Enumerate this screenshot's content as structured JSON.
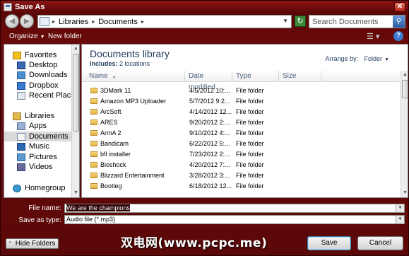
{
  "window": {
    "title": "Save As"
  },
  "address_bar": {
    "segments": [
      "Libraries",
      "Documents"
    ]
  },
  "search": {
    "placeholder": "Search Documents"
  },
  "toolbar": {
    "organize_label": "Organize",
    "new_folder_label": "New folder"
  },
  "nav_pane": {
    "items": [
      {
        "label": "Favorites",
        "icon": "star-icon",
        "group": true
      },
      {
        "label": "Desktop",
        "icon": "desktop-icon"
      },
      {
        "label": "Downloads",
        "icon": "downloads-icon"
      },
      {
        "label": "Dropbox",
        "icon": "dropbox-icon"
      },
      {
        "label": "Recent Places",
        "icon": "recent-places-icon"
      },
      {
        "label": "Libraries",
        "icon": "libraries-icon",
        "group": true
      },
      {
        "label": "Apps",
        "icon": "apps-library-icon"
      },
      {
        "label": "Documents",
        "icon": "documents-library-icon",
        "selected": true
      },
      {
        "label": "Music",
        "icon": "music-library-icon"
      },
      {
        "label": "Pictures",
        "icon": "pictures-library-icon"
      },
      {
        "label": "Videos",
        "icon": "videos-library-icon"
      },
      {
        "label": "Homegroup",
        "icon": "homegroup-icon",
        "group": true
      }
    ]
  },
  "library": {
    "title": "Documents library",
    "includes_label": "Includes:",
    "includes_value": "2 locations",
    "arrange_label": "Arrange by:",
    "arrange_value": "Folder"
  },
  "columns": {
    "name": "Name",
    "date": "Date modified",
    "type": "Type",
    "size": "Size"
  },
  "files": [
    {
      "name": "3DMark 11",
      "date": "4/5/2012 10:...",
      "type": "File folder"
    },
    {
      "name": "Amazon MP3 Uploader",
      "date": "5/7/2012 9:2...",
      "type": "File folder"
    },
    {
      "name": "ArcSoft",
      "date": "4/14/2012 12...",
      "type": "File folder"
    },
    {
      "name": "ARES",
      "date": "9/20/2012 2:...",
      "type": "File folder"
    },
    {
      "name": "ArmA 2",
      "date": "9/10/2012 4:...",
      "type": "File folder"
    },
    {
      "name": "Bandicam",
      "date": "6/22/2012 5:...",
      "type": "File folder"
    },
    {
      "name": "bfl installer",
      "date": "7/23/2012 2:...",
      "type": "File folder"
    },
    {
      "name": "Bioshock",
      "date": "4/20/2012 7:...",
      "type": "File folder"
    },
    {
      "name": "Blizzard Entertainment",
      "date": "3/28/2012 3:...",
      "type": "File folder"
    },
    {
      "name": "Bootleg",
      "date": "6/18/2012 12...",
      "type": "File folder"
    }
  ],
  "save_form": {
    "file_name_label": "File name:",
    "file_name_value": "We are the champions",
    "save_type_label": "Save as type:",
    "save_type_value": "Audio file (*.mp3)"
  },
  "footer": {
    "hide_folders_label": "Hide Folders",
    "save_label": "Save",
    "cancel_label": "Cancel"
  },
  "watermark": "双电网(www.pcpc.me)"
}
